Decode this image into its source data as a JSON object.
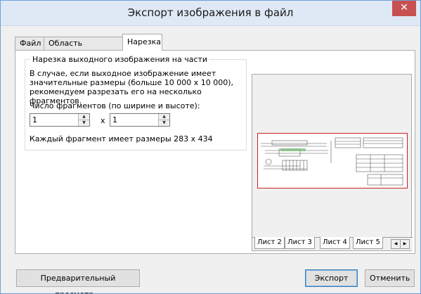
{
  "window": {
    "title": "Экспорт изображения в файл"
  },
  "tabs": [
    {
      "label": "Файл"
    },
    {
      "label": "Область экспорта"
    },
    {
      "label": "Нарезка"
    }
  ],
  "slicing": {
    "group_title": "Нарезка выходного изображения на части",
    "description": "В случае, если выходное изображение имеет значительные размеры (больше 10 000 x 10 000), рекомендуем разрезать его на несколько фрагментов.",
    "count_label": "Число фрагментов (по ширине и высоте):",
    "width_value": "1",
    "height_value": "1",
    "times": "x",
    "fragment_size": "Каждый фрагмент имеет размеры 283 x 434"
  },
  "preview": {
    "sheet_tabs": [
      "Лист 2",
      "Лист 3",
      "Лист 4",
      "Лист 5"
    ]
  },
  "buttons": {
    "preview": "Предварительный просмотр...",
    "export": "Экспорт",
    "cancel": "Отменить"
  },
  "colors": {
    "title_bar": "#dfe9f5",
    "close": "#c75050",
    "sheet_border": "#cc2020"
  }
}
